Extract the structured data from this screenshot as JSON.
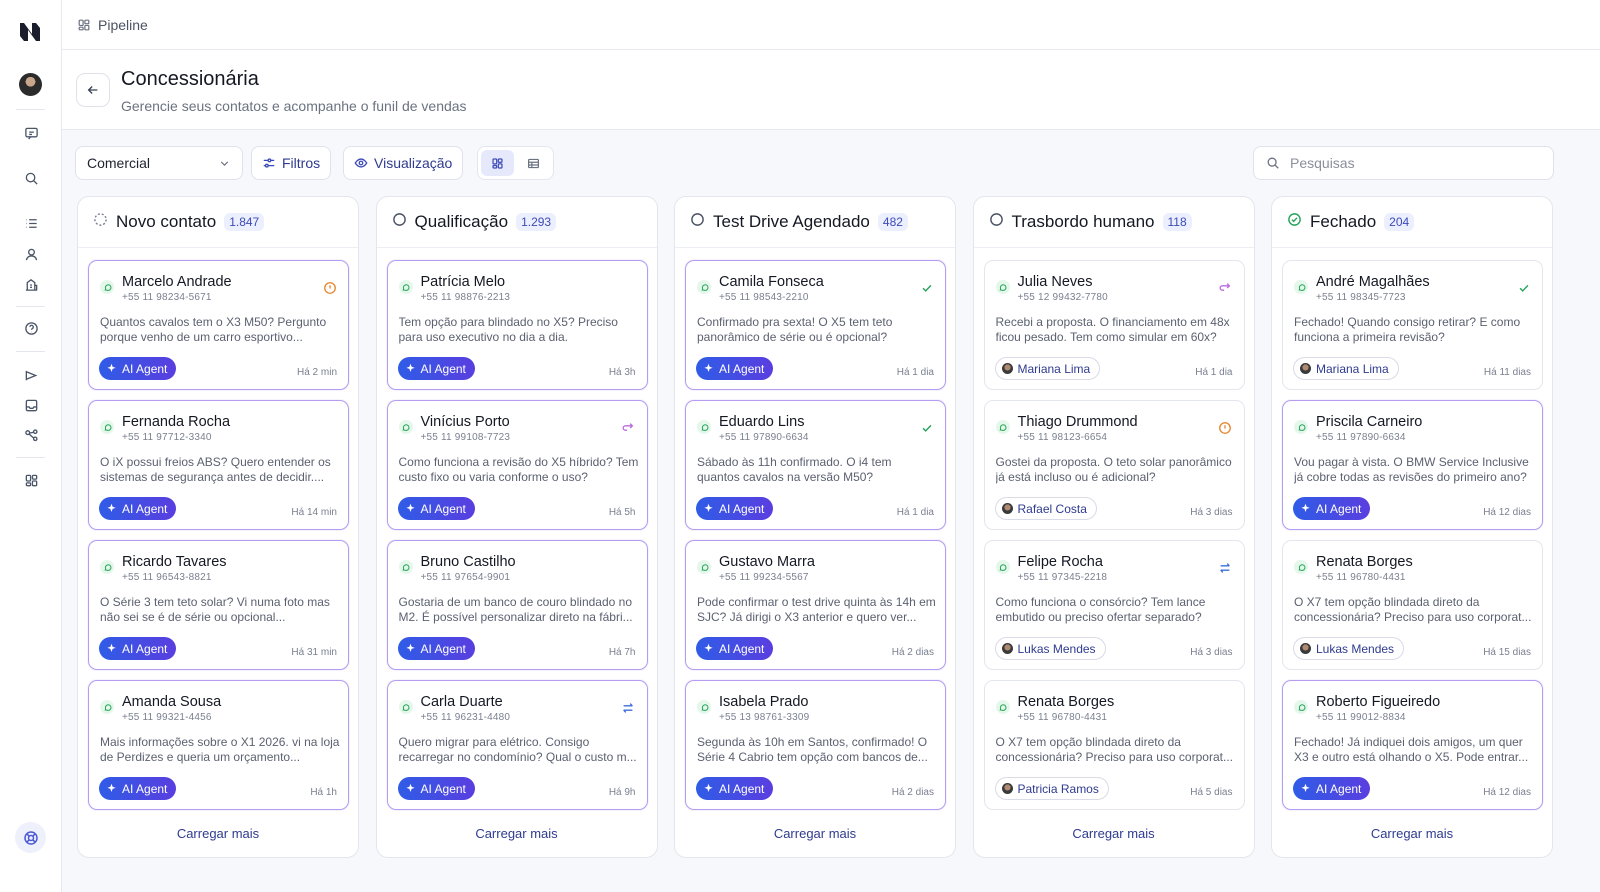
{
  "topbar": {
    "breadcrumb": "Pipeline"
  },
  "header": {
    "title": "Concessionária",
    "subtitle": "Gerencie seus contatos e acompanhe o funil de vendas"
  },
  "toolbar": {
    "pipeline_select": "Comercial",
    "filters_label": "Filtros",
    "view_label": "Visualização",
    "search_placeholder": "Pesquisas"
  },
  "load_more_label": "Carregar mais",
  "colors": {
    "accent": "#3c4bb8",
    "ai_gradient_start": "#2f5ce6",
    "ai_gradient_end": "#5a3ee0",
    "ai_border": "#b59cf0"
  },
  "columns": [
    {
      "title": "Novo contato",
      "count": "1.847",
      "status_icon": "dashed-circle-icon",
      "cards": [
        {
          "name": "Marcelo Andrade",
          "phone": "+55 11 98234-5671",
          "message": "Quantos cavalos tem o X3 M50? Pergunto porque venho de um carro esportivo...",
          "assignee": "AI Agent",
          "time": "Há 2 min",
          "indicator": "alert-icon"
        },
        {
          "name": "Fernanda Rocha",
          "phone": "+55 11 97712-3340",
          "message": "O iX possui freios ABS? Quero entender os sistemas de segurança antes de decidir....",
          "assignee": "AI Agent",
          "time": "Há 14 min",
          "indicator": ""
        },
        {
          "name": "Ricardo Tavares",
          "phone": "+55 11 96543-8821",
          "message": "O Série 3 tem teto solar? Vi numa foto mas não sei se é de série ou opcional...",
          "assignee": "AI Agent",
          "time": "Há 31 min",
          "indicator": ""
        },
        {
          "name": "Amanda Sousa",
          "phone": "+55 11 99321-4456",
          "message": "Mais informações sobre o X1 2026. vi na loja de Perdizes e queria um orçamento...",
          "assignee": "AI Agent",
          "time": "Há 1h",
          "indicator": ""
        }
      ]
    },
    {
      "title": "Qualificação",
      "count": "1.293",
      "status_icon": "circle-icon",
      "cards": [
        {
          "name": "Patrícia Melo",
          "phone": "+55 11 98876-2213",
          "message": "Tem opção para blindado no X5? Preciso para uso executivo no dia a dia.",
          "assignee": "AI Agent",
          "time": "Há 3h",
          "indicator": ""
        },
        {
          "name": "Vinícius Porto",
          "phone": "+55 11 99108-7723",
          "message": "Como funciona a revisão do X5 híbrido? Tem custo fixo ou varia conforme o uso?",
          "assignee": "AI Agent",
          "time": "Há 5h",
          "indicator": "return-icon"
        },
        {
          "name": "Bruno Castilho",
          "phone": "+55 11 97654-9901",
          "message": "Gostaria de um banco de couro blindado no M2. É possível personalizar direto na fábri...",
          "assignee": "AI Agent",
          "time": "Há 7h",
          "indicator": ""
        },
        {
          "name": "Carla Duarte",
          "phone": "+55 11 96231-4480",
          "message": "Quero migrar para elétrico. Consigo recarregar no condomínio? Qual o custo m...",
          "assignee": "AI Agent",
          "time": "Há 9h",
          "indicator": "transfer-icon"
        }
      ]
    },
    {
      "title": "Test Drive Agendado",
      "count": "482",
      "status_icon": "circle-icon",
      "cards": [
        {
          "name": "Camila Fonseca",
          "phone": "+55 11 98543-2210",
          "message": "Confirmado pra sexta! O X5 tem teto panorâmico de série ou é opcional?",
          "assignee": "AI Agent",
          "time": "Há 1 dia",
          "indicator": "check-icon"
        },
        {
          "name": "Eduardo Lins",
          "phone": "+55 11 97890-6634",
          "message": "Sábado às 11h confirmado. O i4 tem quantos cavalos na versão M50?",
          "assignee": "AI Agent",
          "time": "Há 1 dia",
          "indicator": "check-icon"
        },
        {
          "name": "Gustavo Marra",
          "phone": "+55 11 99234-5567",
          "message": "Pode confirmar o test drive quinta às 14h em SJC? Já dirigi o X3 anterior e quero ver...",
          "assignee": "AI Agent",
          "time": "Há 2 dias",
          "indicator": ""
        },
        {
          "name": "Isabela Prado",
          "phone": "+55 13 98761-3309",
          "message": "Segunda às 10h em Santos, confirmado! O Série 4 Cabrio tem opção com bancos de...",
          "assignee": "AI Agent",
          "time": "Há 2 dias",
          "indicator": ""
        }
      ]
    },
    {
      "title": "Trasbordo humano",
      "count": "118",
      "status_icon": "circle-icon",
      "cards": [
        {
          "name": "Julia Neves",
          "phone": "+55 12 99432-7780",
          "message": "Recebi a proposta. O financiamento em 48x ficou pesado. Tem como simular em 60x?",
          "assignee": "Mariana Lima",
          "time": "Há 1 dia",
          "indicator": "return-icon"
        },
        {
          "name": "Thiago Drummond",
          "phone": "+55 11 98123-6654",
          "message": "Gostei da proposta. O teto solar panorâmico já está incluso ou é adicional?",
          "assignee": "Rafael Costa",
          "time": "Há 3 dias",
          "indicator": "alert-icon"
        },
        {
          "name": "Felipe Rocha",
          "phone": "+55 11 97345-2218",
          "message": "Como funciona o consórcio? Tem lance embutido ou preciso ofertar separado?",
          "assignee": "Lukas Mendes",
          "time": "Há 3 dias",
          "indicator": "transfer-icon"
        },
        {
          "name": "Renata Borges",
          "phone": "+55 11 96780-4431",
          "message": "O X7 tem opção blindada direto da concessionária? Preciso para uso corporat...",
          "assignee": "Patricia Ramos",
          "time": "Há 5 dias",
          "indicator": ""
        }
      ]
    },
    {
      "title": "Fechado",
      "count": "204",
      "status_icon": "check-circle-icon",
      "cards": [
        {
          "name": "André Magalhães",
          "phone": "+55 11 98345-7723",
          "message": "Fechado! Quando consigo retirar? E como funciona a primeira revisão?",
          "assignee": "Mariana Lima",
          "time": "Há 11 dias",
          "indicator": "check-icon"
        },
        {
          "name": "Priscila Carneiro",
          "phone": "+55 11 97890-6634",
          "message": "Vou pagar à vista. O BMW Service Inclusive já cobre todas as revisões do primeiro ano?",
          "assignee": "AI Agent",
          "time": "Há 12 dias",
          "indicator": ""
        },
        {
          "name": "Renata Borges",
          "phone": "+55 11 96780-4431",
          "message": "O X7 tem opção blindada direto da concessionária? Preciso para uso corporat...",
          "assignee": "Lukas Mendes",
          "time": "Há 15 dias",
          "indicator": ""
        },
        {
          "name": "Roberto Figueiredo",
          "phone": "+55 11 99012-8834",
          "message": "Fechado! Já indiquei dois amigos, um quer X3 e outro está olhando o X5. Pode entrar...",
          "assignee": "AI Agent",
          "time": "Há 12 dias",
          "indicator": ""
        }
      ]
    }
  ]
}
